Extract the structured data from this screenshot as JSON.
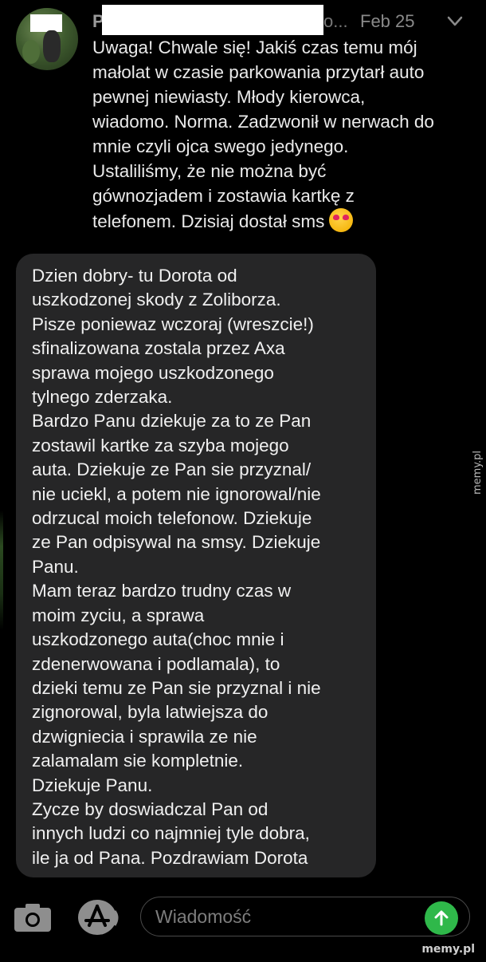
{
  "post": {
    "sender_initial": "P",
    "sender_trail": "o...",
    "date": "Feb 25",
    "body": "Uwaga! Chwale się! Jakiś czas temu mój\nmałolat w czasie parkowania przytarł auto\npewnej niewiasty. Młody kierowca,\nwiadomo. Norma. Zadzwonił w nerwach do\nmnie czyli ojca swego jedynego.\nUstaliliśmy, że nie można być\ngównozjadem i zostawia kartkę z\ntelefonem. Dzisiaj dostał sms",
    "emoji": "heart-eyes-emoji"
  },
  "sms": {
    "text": "Dzien dobry- tu Dorota od\nuszkodzonej skody z Zoliborza.\nPisze poniewaz wczoraj (wreszcie!)\nsfinalizowana zostala przez Axa\nsprawa mojego uszkodzonego\ntylnego zderzaka.\nBardzo Panu dziekuje za to ze Pan\nzostawil kartke za szyba mojego\nauta. Dziekuje ze Pan sie przyznal/\nnie uciekl, a potem nie ignorowal/nie\nodrzucal moich telefonow. Dziekuje\nze Pan odpisywal na smsy. Dziekuje\nPanu.\nMam teraz bardzo trudny czas w\nmoim zyciu, a sprawa\nuszkodzonego auta(choc mnie i\nzdenerwowana i podlamala), to\ndzieki temu ze Pan sie przyznal i nie\nzignorowal, byla latwiejsza do\ndzwigniecia i sprawila ze nie\nzalamalam sie kompletnie.\nDziekuje Panu.\nZycze by doswiadczal Pan od\ninnych ludzi co najmniej tyle dobra,\nile ja od Pana. Pozdrawiam Dorota"
  },
  "composer": {
    "placeholder": "Wiadomość"
  },
  "watermarks": {
    "side": "memy.pl",
    "bottom": "memy.pl"
  },
  "colors": {
    "background": "#000000",
    "bubble": "#262627",
    "send_button": "#2fb84a"
  }
}
